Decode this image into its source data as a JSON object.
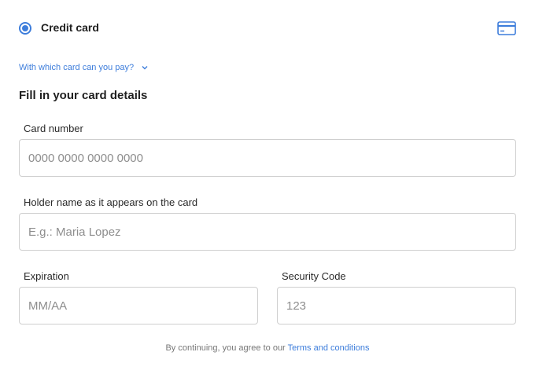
{
  "payment_method": {
    "label": "Credit card",
    "icon": "credit-card-icon",
    "accent_color": "#3d7ddb"
  },
  "help_link": {
    "label": "With which card can you pay?",
    "icon": "chevron-down-icon"
  },
  "section_title": "Fill in your card details",
  "fields": {
    "card_number": {
      "label": "Card number",
      "placeholder": "0000 0000 0000 0000",
      "value": ""
    },
    "holder_name": {
      "label": "Holder name as it appears on the card",
      "placeholder": "E.g.: Maria Lopez",
      "value": ""
    },
    "expiration": {
      "label": "Expiration",
      "placeholder": "MM/AA",
      "value": ""
    },
    "security_code": {
      "label": "Security Code",
      "placeholder": "123",
      "value": ""
    }
  },
  "footer": {
    "text": "By continuing, you agree to our ",
    "link": "Terms and conditions"
  }
}
